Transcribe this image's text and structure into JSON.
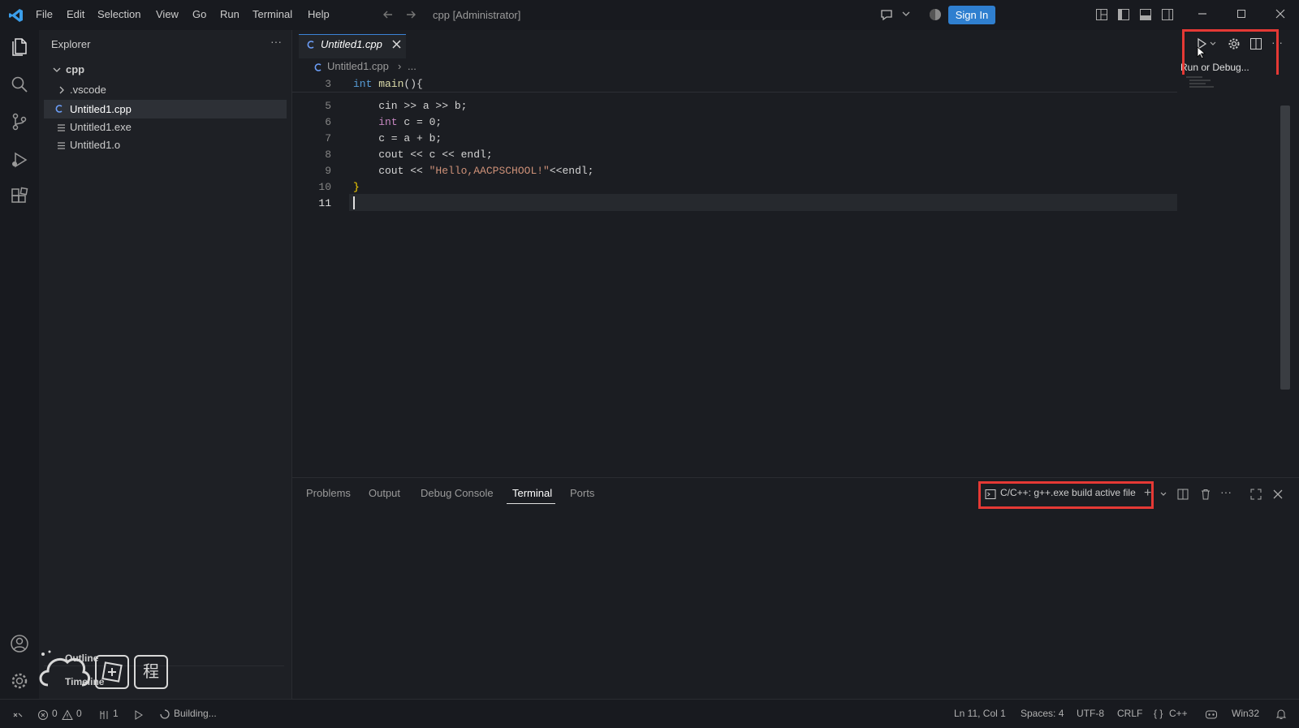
{
  "menu": [
    "File",
    "Edit",
    "Selection",
    "View",
    "Go",
    "Run",
    "Terminal",
    "Help"
  ],
  "window": {
    "title": "cpp [Administrator]",
    "sign_in": "Sign In"
  },
  "explorer": {
    "title": "Explorer",
    "more": "···",
    "root": "cpp",
    "items": [
      ".vscode",
      "Untitled1.cpp",
      "Untitled1.exe",
      "Untitled1.o"
    ],
    "outline": "Outline",
    "timeline": "Timeline"
  },
  "tab": {
    "label": "Untitled1.cpp"
  },
  "breadcrumb": {
    "file": "Untitled1.cpp",
    "rest": "..."
  },
  "code": {
    "line_numbers": [
      "3",
      "5",
      "6",
      "7",
      "8",
      "9",
      "10",
      "11"
    ],
    "lines": [
      {
        "kw": "int",
        "fn": " main",
        "rest": "(){"
      },
      {
        "text": "    cin >> a >> b;"
      },
      {
        "kw": "    int",
        "rest": " c = 0;"
      },
      {
        "text": "    c = a + b;"
      },
      {
        "text": "    cout << c << endl;"
      },
      {
        "pre": "    cout << ",
        "str": "\"Hello,AACPSCHOOL!\"",
        "post": "<<endl;"
      },
      {
        "br": "}"
      }
    ]
  },
  "run_tooltip": "Run or Debug...",
  "panel": {
    "tabs": [
      "Problems",
      "Output",
      "Debug Console",
      "Terminal",
      "Ports"
    ],
    "active_tab": "Terminal",
    "task": "C/C++: g++.exe build active file"
  },
  "status": {
    "errors": "0",
    "warnings": "0",
    "ports": "1",
    "building": "Building...",
    "cursor": "Ln 11, Col 1",
    "spaces": "Spaces: 4",
    "encoding": "UTF-8",
    "eol": "CRLF",
    "language": "C++",
    "platform": "Win32"
  },
  "overlay_char": "程",
  "colors": {
    "accent": "#2f7fcf",
    "highlight": "#e53935",
    "keyword": "#569cd6",
    "string": "#ce9178"
  }
}
